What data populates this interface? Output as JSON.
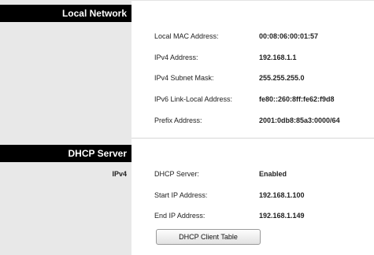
{
  "local_network": {
    "header": "Local Network",
    "rows": [
      {
        "label": "Local MAC Address:",
        "value": "00:08:06:00:01:57"
      },
      {
        "label": "IPv4 Address:",
        "value": "192.168.1.1"
      },
      {
        "label": "IPv4 Subnet Mask:",
        "value": "255.255.255.0"
      },
      {
        "label": "IPv6 Link-Local Address:",
        "value": "fe80::260:8ff:fe62:f9d8"
      },
      {
        "label": "Prefix Address:",
        "value": "2001:0db8:85a3:0000/64"
      }
    ]
  },
  "dhcp_server": {
    "header": "DHCP Server",
    "sub_label": "IPv4",
    "rows": [
      {
        "label": "DHCP Server:",
        "value": "Enabled"
      },
      {
        "label": "Start IP Address:",
        "value": "192.168.1.100"
      },
      {
        "label": "End IP Address:",
        "value": "192.168.1.149"
      }
    ],
    "button_label": "DHCP Client Table"
  },
  "colors": {
    "header_bg": "#000000",
    "header_text": "#ffffff",
    "sidebar_bg": "#e8e8e8"
  }
}
